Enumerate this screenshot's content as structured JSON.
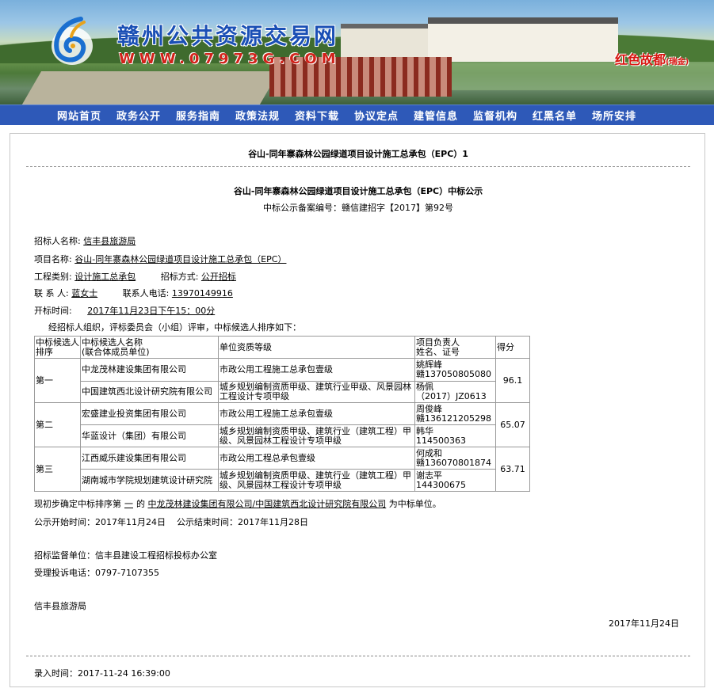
{
  "header": {
    "site_title": "赣州公共资源交易网",
    "site_url": "WWW.07973G.COM",
    "slogan_main": "红色故都",
    "slogan_small": "(瑞金)"
  },
  "nav": {
    "items": [
      "网站首页",
      "政务公开",
      "服务指南",
      "政策法规",
      "资料下载",
      "协议定点",
      "建管信息",
      "监督机构",
      "红黑名单",
      "场所安排"
    ]
  },
  "page": {
    "title": "谷山-同年寨森林公园绿道项目设计施工总承包（EPC）1",
    "notice_title": "谷山-同年寨森林公园绿道项目设计施工总承包（EPC）中标公示",
    "notice_record": "中标公示备案编号：赣信建招字【2017】第92号"
  },
  "info": {
    "tenderer_label": "招标人名称:",
    "tenderer_value": "信丰县旅游局",
    "project_label": "项目名称:",
    "project_value": "谷山-同年寨森林公园绿道项目设计施工总承包（EPC）",
    "category_label": "工程类别:",
    "category_value": "设计施工总承包",
    "method_label": "招标方式:",
    "method_value": "公开招标",
    "contact_label": "联 系 人:",
    "contact_value": "蓝女士",
    "phone_label": "联系人电话:",
    "phone_value": "13970149916",
    "opening_label": "开标时间:",
    "opening_value": "2017年11月23日下午15：00分",
    "intro": "经招标人组织，评标委员会（小组）评审，中标候选人排序如下："
  },
  "table": {
    "headers": {
      "rank": "中标候选人排序",
      "name_a": "中标候选人名称",
      "name_b": "(联合体成员单位)",
      "qual": "单位资质等级",
      "pm_a": "项目负责人",
      "pm_b": "姓名、证号",
      "score": "得分"
    },
    "groups": [
      {
        "rank": "第一",
        "score": "96.1",
        "members": [
          {
            "name": "中龙茂林建设集团有限公司",
            "qual": "市政公用工程施工总承包壹级",
            "pm": "姚辉峰",
            "cert_prefix": "赣",
            "cert": "137050805080"
          },
          {
            "name": "中国建筑西北设计研究院有限公司",
            "qual": "城乡规划编制资质甲级、建筑行业甲级、风景园林工程设计专项甲级",
            "pm": "杨佩",
            "cert_prefix": "",
            "cert": "（2017）JZ0613"
          }
        ]
      },
      {
        "rank": "第二",
        "score": "65.07",
        "members": [
          {
            "name": "宏盛建业投资集团有限公司",
            "qual": "市政公用工程施工总承包壹级",
            "pm": "周俊峰",
            "cert_prefix": "赣",
            "cert": "136121205298"
          },
          {
            "name": "华蓝设计（集团）有限公司",
            "qual": "城乡规划编制资质甲级、建筑行业（建筑工程）甲级、风景园林工程设计专项甲级",
            "pm": "韩华",
            "cert_prefix": "",
            "cert": "114500363"
          }
        ]
      },
      {
        "rank": "第三",
        "score": "63.71",
        "members": [
          {
            "name": "江西威乐建设集团有限公司",
            "qual": "市政公用工程总承包壹级",
            "pm": "何成和",
            "cert_prefix": "赣",
            "cert": "136070801874"
          },
          {
            "name": "湖南城市学院规划建筑设计研究院",
            "qual": "城乡规划编制资质甲级、建筑行业（建筑工程）甲级、风景园林工程设计专项甲级",
            "pm": "谢志平",
            "cert_prefix": "",
            "cert": "144300675"
          }
        ]
      }
    ]
  },
  "result": {
    "prefix": "现初步确定中标排序第",
    "rank_value": "一",
    "middle": "的",
    "winner": "中龙茂林建设集团有限公司/中国建筑西北设计研究院有限公司",
    "suffix": "为中标单位。",
    "start_label": "公示开始时间：",
    "start_value": "2017年11月24日",
    "end_label": "公示结束时间：",
    "end_value": "2017年11月28日",
    "supervisor_label": "招标监督单位：",
    "supervisor_value": "信丰县建设工程招标投标办公室",
    "complaint_label": "受理投诉电话：",
    "complaint_value": "0797-7107355",
    "org": "信丰县旅游局",
    "date": "2017年11月24日",
    "entry_label": "录入时间：",
    "entry_value": "2017-11-24 16:39:00"
  },
  "colors": {
    "title_blue": "#1a4fb5",
    "url_red": "#d2231b",
    "nav_blue": "#2e59b8"
  },
  "icons": {
    "logo": "stylized-6-swirl-logo"
  }
}
